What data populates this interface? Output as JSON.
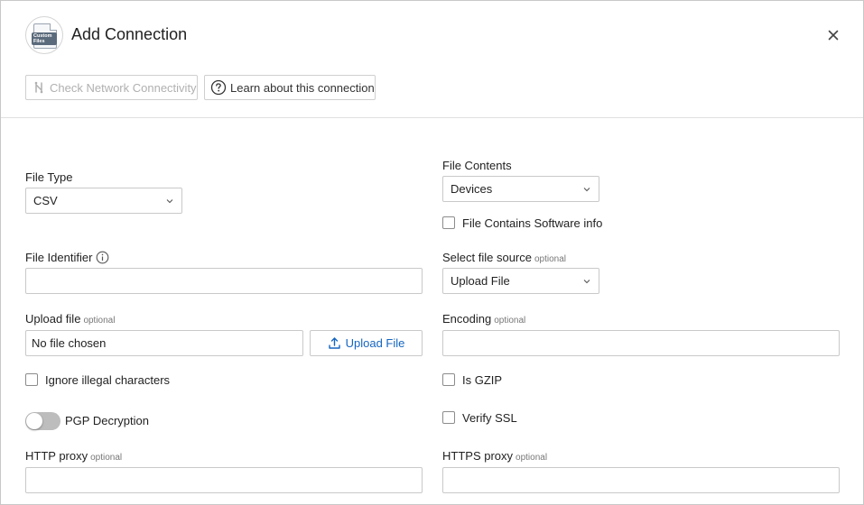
{
  "dialog": {
    "title": "Add Connection",
    "logo_text": "Custom Files",
    "check_network_label": "Check Network Connectivity",
    "learn_label": "Learn about this connection"
  },
  "form": {
    "file_type": {
      "label": "File Type",
      "value": "CSV"
    },
    "file_contents": {
      "label": "File Contents",
      "value": "Devices"
    },
    "software_info": {
      "label": "File Contains Software info",
      "checked": false
    },
    "file_identifier": {
      "label": "File Identifier",
      "value": ""
    },
    "file_source": {
      "label": "Select file source",
      "optional": "optional",
      "value": "Upload File"
    },
    "upload_file": {
      "label": "Upload file",
      "optional": "optional",
      "value": "No file chosen",
      "button_label": "Upload File"
    },
    "encoding": {
      "label": "Encoding",
      "optional": "optional",
      "value": ""
    },
    "ignore_illegal": {
      "label": "Ignore illegal characters",
      "checked": false
    },
    "is_gzip": {
      "label": "Is GZIP",
      "checked": false
    },
    "pgp": {
      "label": "PGP Decryption",
      "enabled": false
    },
    "verify_ssl": {
      "label": "Verify SSL",
      "checked": false
    },
    "http_proxy": {
      "label": "HTTP proxy",
      "optional": "optional",
      "value": ""
    },
    "https_proxy": {
      "label": "HTTPS proxy",
      "optional": "optional",
      "value": ""
    }
  },
  "colors": {
    "link": "#1565c0",
    "border": "#c9c9c9",
    "disabled_text": "#b0b0b0",
    "toggle_off": "#bdbdbd"
  }
}
